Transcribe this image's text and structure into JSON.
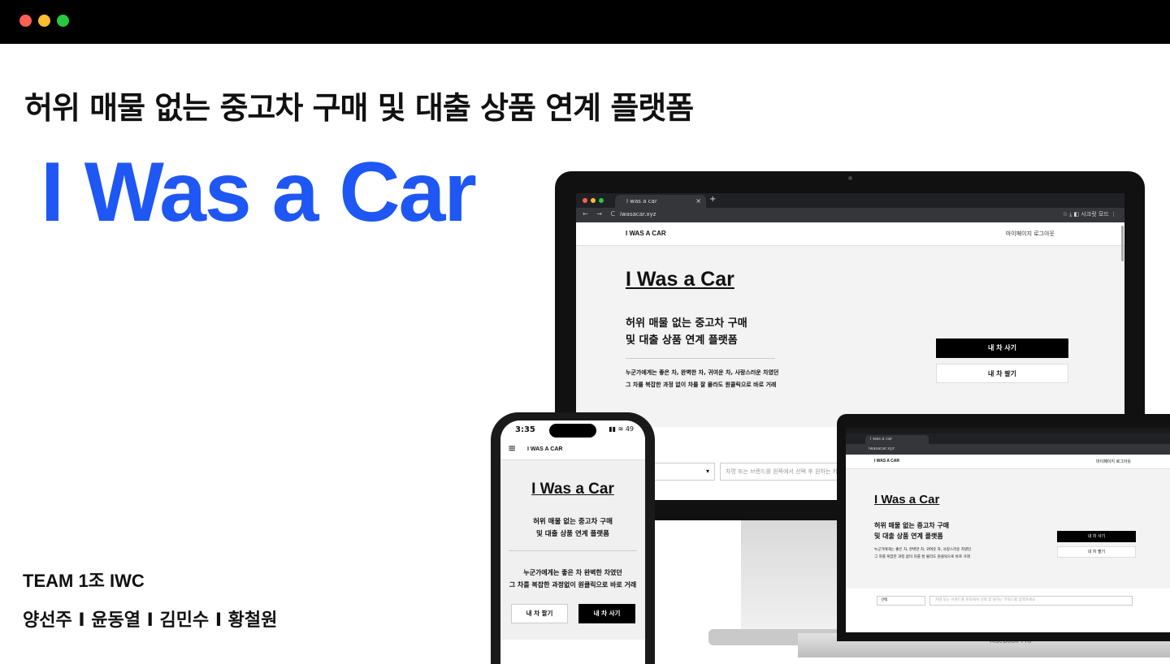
{
  "window": {
    "traffic_lights": {
      "close": "#ff5f57",
      "minimize": "#febc2e",
      "zoom": "#28c840"
    },
    "accent": "#1f57f5"
  },
  "slide": {
    "subtitle": "허위 매물 없는 중고차 구매 및 대출 상품 연계 플랫폼",
    "title": "I Was a Car",
    "team": "TEAM 1조 IWC",
    "members": "양선주 I 윤동열 I 김민수 I 황철원"
  },
  "monitor": {
    "tab_title": "I was a car",
    "tab_close": "×",
    "new_tab": "+",
    "nav": "← → C",
    "url": "iwasacar.xyz",
    "chrome_right": "☆  ⤓  ◧  시크릿 모드  ⋮",
    "site": {
      "logo": "I WAS A CAR",
      "nav": "마이페이지    로그아웃",
      "title": "I Was a Car",
      "subtitle_line1": "허위 매물 없는 중고차 구매",
      "subtitle_line2": "및 대출 상품 연계 플랫폼",
      "desc_line1": "누군가에게는 좋은 차, 완벽한 차, 귀여운 차, 사랑스러운 차였던",
      "desc_line2": "그 차를 복잡한 과정 없이 차를 잘 몰라도 원클릭으로 바로 거래",
      "buy_button": "내 차 사기",
      "sell_button": "내 차 팔기",
      "select_arrow": "▾",
      "search_placeholder": "차명 또는 브랜드를 왼쪽에서 선택 후 원하는 키워드를 입력하세요"
    }
  },
  "laptop": {
    "tab_title": "I was a car",
    "url": "iwasacar.xyz",
    "brand": "MacBook Pro",
    "site": {
      "logo": "I WAS A CAR",
      "nav": "마이페이지   로그아웃",
      "title": "I Was a Car",
      "subtitle_line1": "허위 매물 없는 중고차 구매",
      "subtitle_line2": "및 대출 상품 연계 플랫폼",
      "desc_line1": "누군가에게는 좋은 차, 완벽한 차, 귀여운 차, 사랑스러운 차였던",
      "desc_line2": "그 차를 복잡한 과정 없이 차를 잘 몰라도 원클릭으로 바로 거래",
      "buy_button": "내 차 사기",
      "sell_button": "내 차 팔기",
      "select_label": "선택",
      "search_placeholder": "차명 또는 브랜드를 왼쪽에서 선택 후 원하는 키워드를 입력하세요"
    }
  },
  "phone": {
    "time": "3:35",
    "status_right": "▮▮ ≋ 49",
    "menu_icon": "≡",
    "site": {
      "logo": "I WAS A CAR",
      "title": "I Was a Car",
      "subtitle_line1": "허위 매물 없는 중고차 구매",
      "subtitle_line2": "및 대출 상품 연계 플랫폼",
      "desc_line1": "누군가에게는 좋은 차 완벽한 차였던",
      "desc_line2": "그 차를 복잡한 과정없이 원클릭으로 바로 거래",
      "sell_button": "내 차 팔기",
      "buy_button": "내 차 사기"
    }
  }
}
